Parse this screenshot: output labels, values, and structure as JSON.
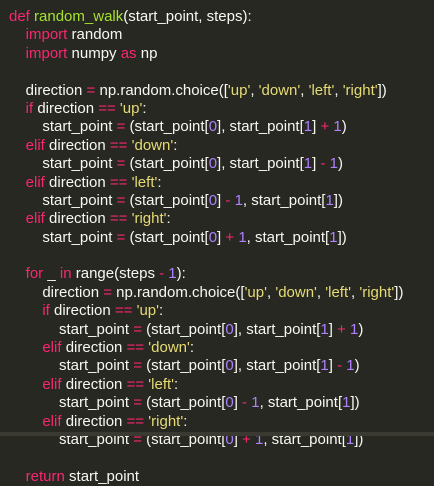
{
  "colors": {
    "background": "#272822",
    "keyword": "#f92672",
    "function_name": "#a6e22e",
    "string": "#e6db74",
    "number": "#ae81ff",
    "default": "#f8f8f2"
  },
  "code_lines": [
    [
      {
        "t": "def",
        "c": "keyword"
      },
      {
        "t": " "
      },
      {
        "t": "random_walk",
        "c": "function_name"
      },
      {
        "t": "(start_point, steps):"
      }
    ],
    [
      {
        "t": "    "
      },
      {
        "t": "import",
        "c": "keyword"
      },
      {
        "t": " random"
      }
    ],
    [
      {
        "t": "    "
      },
      {
        "t": "import",
        "c": "keyword"
      },
      {
        "t": " numpy "
      },
      {
        "t": "as",
        "c": "keyword"
      },
      {
        "t": " np"
      }
    ],
    [],
    [
      {
        "t": "    direction "
      },
      {
        "t": "=",
        "c": "keyword"
      },
      {
        "t": " np.random.choice(["
      },
      {
        "t": "'up'",
        "c": "string"
      },
      {
        "t": ", "
      },
      {
        "t": "'down'",
        "c": "string"
      },
      {
        "t": ", "
      },
      {
        "t": "'left'",
        "c": "string"
      },
      {
        "t": ", "
      },
      {
        "t": "'right'",
        "c": "string"
      },
      {
        "t": "])"
      }
    ],
    [
      {
        "t": "    "
      },
      {
        "t": "if",
        "c": "keyword"
      },
      {
        "t": " direction "
      },
      {
        "t": "==",
        "c": "keyword"
      },
      {
        "t": " "
      },
      {
        "t": "'up'",
        "c": "string"
      },
      {
        "t": ":"
      }
    ],
    [
      {
        "t": "        start_point "
      },
      {
        "t": "=",
        "c": "keyword"
      },
      {
        "t": " (start_point["
      },
      {
        "t": "0",
        "c": "number"
      },
      {
        "t": "], start_point["
      },
      {
        "t": "1",
        "c": "number"
      },
      {
        "t": "] "
      },
      {
        "t": "+",
        "c": "keyword"
      },
      {
        "t": " "
      },
      {
        "t": "1",
        "c": "number"
      },
      {
        "t": ")"
      }
    ],
    [
      {
        "t": "    "
      },
      {
        "t": "elif",
        "c": "keyword"
      },
      {
        "t": " direction "
      },
      {
        "t": "==",
        "c": "keyword"
      },
      {
        "t": " "
      },
      {
        "t": "'down'",
        "c": "string"
      },
      {
        "t": ":"
      }
    ],
    [
      {
        "t": "        start_point "
      },
      {
        "t": "=",
        "c": "keyword"
      },
      {
        "t": " (start_point["
      },
      {
        "t": "0",
        "c": "number"
      },
      {
        "t": "], start_point["
      },
      {
        "t": "1",
        "c": "number"
      },
      {
        "t": "] "
      },
      {
        "t": "-",
        "c": "keyword"
      },
      {
        "t": " "
      },
      {
        "t": "1",
        "c": "number"
      },
      {
        "t": ")"
      }
    ],
    [
      {
        "t": "    "
      },
      {
        "t": "elif",
        "c": "keyword"
      },
      {
        "t": " direction "
      },
      {
        "t": "==",
        "c": "keyword"
      },
      {
        "t": " "
      },
      {
        "t": "'left'",
        "c": "string"
      },
      {
        "t": ":"
      }
    ],
    [
      {
        "t": "        start_point "
      },
      {
        "t": "=",
        "c": "keyword"
      },
      {
        "t": " (start_point["
      },
      {
        "t": "0",
        "c": "number"
      },
      {
        "t": "] "
      },
      {
        "t": "-",
        "c": "keyword"
      },
      {
        "t": " "
      },
      {
        "t": "1",
        "c": "number"
      },
      {
        "t": ", start_point["
      },
      {
        "t": "1",
        "c": "number"
      },
      {
        "t": "])"
      }
    ],
    [
      {
        "t": "    "
      },
      {
        "t": "elif",
        "c": "keyword"
      },
      {
        "t": " direction "
      },
      {
        "t": "==",
        "c": "keyword"
      },
      {
        "t": " "
      },
      {
        "t": "'right'",
        "c": "string"
      },
      {
        "t": ":"
      }
    ],
    [
      {
        "t": "        start_point "
      },
      {
        "t": "=",
        "c": "keyword"
      },
      {
        "t": " (start_point["
      },
      {
        "t": "0",
        "c": "number"
      },
      {
        "t": "] "
      },
      {
        "t": "+",
        "c": "keyword"
      },
      {
        "t": " "
      },
      {
        "t": "1",
        "c": "number"
      },
      {
        "t": ", start_point["
      },
      {
        "t": "1",
        "c": "number"
      },
      {
        "t": "])"
      }
    ],
    [],
    [
      {
        "t": "    "
      },
      {
        "t": "for",
        "c": "keyword"
      },
      {
        "t": " _ "
      },
      {
        "t": "in",
        "c": "keyword"
      },
      {
        "t": " range(steps "
      },
      {
        "t": "-",
        "c": "keyword"
      },
      {
        "t": " "
      },
      {
        "t": "1",
        "c": "number"
      },
      {
        "t": "):"
      }
    ],
    [
      {
        "t": "        direction "
      },
      {
        "t": "=",
        "c": "keyword"
      },
      {
        "t": " np.random.choice(["
      },
      {
        "t": "'up'",
        "c": "string"
      },
      {
        "t": ", "
      },
      {
        "t": "'down'",
        "c": "string"
      },
      {
        "t": ", "
      },
      {
        "t": "'left'",
        "c": "string"
      },
      {
        "t": ", "
      },
      {
        "t": "'right'",
        "c": "string"
      },
      {
        "t": "])"
      }
    ],
    [
      {
        "t": "        "
      },
      {
        "t": "if",
        "c": "keyword"
      },
      {
        "t": " direction "
      },
      {
        "t": "==",
        "c": "keyword"
      },
      {
        "t": " "
      },
      {
        "t": "'up'",
        "c": "string"
      },
      {
        "t": ":"
      }
    ],
    [
      {
        "t": "            start_point "
      },
      {
        "t": "=",
        "c": "keyword"
      },
      {
        "t": " (start_point["
      },
      {
        "t": "0",
        "c": "number"
      },
      {
        "t": "], start_point["
      },
      {
        "t": "1",
        "c": "number"
      },
      {
        "t": "] "
      },
      {
        "t": "+",
        "c": "keyword"
      },
      {
        "t": " "
      },
      {
        "t": "1",
        "c": "number"
      },
      {
        "t": ")"
      }
    ],
    [
      {
        "t": "        "
      },
      {
        "t": "elif",
        "c": "keyword"
      },
      {
        "t": " direction "
      },
      {
        "t": "==",
        "c": "keyword"
      },
      {
        "t": " "
      },
      {
        "t": "'down'",
        "c": "string"
      },
      {
        "t": ":"
      }
    ],
    [
      {
        "t": "            start_point "
      },
      {
        "t": "=",
        "c": "keyword"
      },
      {
        "t": " (start_point["
      },
      {
        "t": "0",
        "c": "number"
      },
      {
        "t": "], start_point["
      },
      {
        "t": "1",
        "c": "number"
      },
      {
        "t": "] "
      },
      {
        "t": "-",
        "c": "keyword"
      },
      {
        "t": " "
      },
      {
        "t": "1",
        "c": "number"
      },
      {
        "t": ")"
      }
    ],
    [
      {
        "t": "        "
      },
      {
        "t": "elif",
        "c": "keyword"
      },
      {
        "t": " direction "
      },
      {
        "t": "==",
        "c": "keyword"
      },
      {
        "t": " "
      },
      {
        "t": "'left'",
        "c": "string"
      },
      {
        "t": ":"
      }
    ],
    [
      {
        "t": "            start_point "
      },
      {
        "t": "=",
        "c": "keyword"
      },
      {
        "t": " (start_point["
      },
      {
        "t": "0",
        "c": "number"
      },
      {
        "t": "] "
      },
      {
        "t": "-",
        "c": "keyword"
      },
      {
        "t": " "
      },
      {
        "t": "1",
        "c": "number"
      },
      {
        "t": ", start_point["
      },
      {
        "t": "1",
        "c": "number"
      },
      {
        "t": "])"
      }
    ],
    [
      {
        "t": "        "
      },
      {
        "t": "elif",
        "c": "keyword"
      },
      {
        "t": " direction "
      },
      {
        "t": "==",
        "c": "keyword"
      },
      {
        "t": " "
      },
      {
        "t": "'right'",
        "c": "string"
      },
      {
        "t": ":"
      }
    ],
    [
      {
        "t": "            start_point "
      },
      {
        "t": "=",
        "c": "keyword"
      },
      {
        "t": " (start_point["
      },
      {
        "t": "0",
        "c": "number"
      },
      {
        "t": "] "
      },
      {
        "t": "+",
        "c": "keyword"
      },
      {
        "t": " "
      },
      {
        "t": "1",
        "c": "number"
      },
      {
        "t": ", start_point["
      },
      {
        "t": "1",
        "c": "number"
      },
      {
        "t": "])"
      }
    ],
    [],
    [
      {
        "t": "    "
      },
      {
        "t": "return",
        "c": "keyword"
      },
      {
        "t": " start_point"
      }
    ]
  ]
}
